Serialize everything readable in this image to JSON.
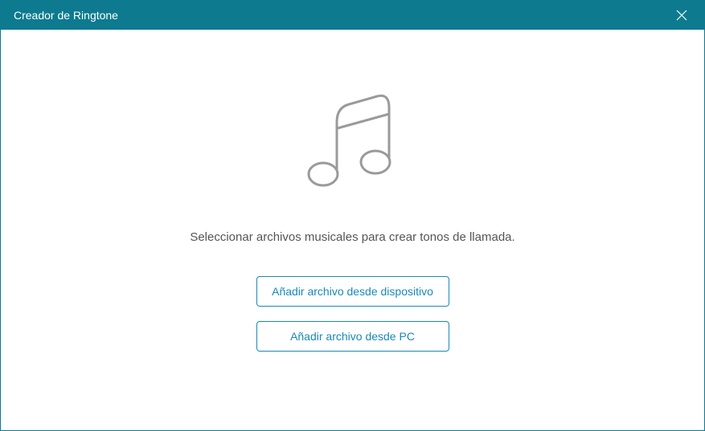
{
  "titlebar": {
    "title": "Creador de Ringtone"
  },
  "content": {
    "instruction": "Seleccionar archivos musicales para crear tonos de llamada.",
    "add_from_device_label": "Añadir archivo desde dispositivo",
    "add_from_pc_label": "Añadir archivo desde PC"
  }
}
